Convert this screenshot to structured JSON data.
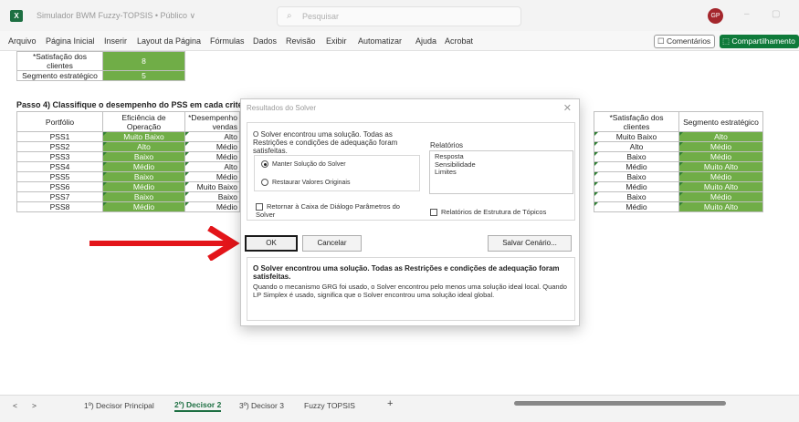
{
  "titlebar": {
    "doc_title": "Simulador BWM Fuzzy-TOPSIS  •  Público ∨",
    "search_placeholder": "Pesquisar",
    "avatar_initials": "GP",
    "minimize": "–",
    "restore": "▢"
  },
  "menu": [
    "Arquivo",
    "Página Inicial",
    "Inserir",
    "Layout da Página",
    "Fórmulas",
    "Dados",
    "Revisão",
    "Exibir",
    "Automatizar",
    "Ajuda",
    "Acrobat"
  ],
  "ribbon": {
    "comments": "☐ Comentários",
    "share": "⬚ Compartilhamento"
  },
  "top_rows": [
    {
      "label": "*Satisfação dos clientes",
      "value": "8"
    },
    {
      "label": "Segmento estratégico",
      "value": "5"
    }
  ],
  "step_title": "Passo 4) Classifique o desempenho do PSS em cada critério",
  "left_table": {
    "headers": [
      "Portfólio",
      "Eficiência de Operação",
      "*Desempenho vendas"
    ],
    "rows": [
      [
        "PSS1",
        "Muito Baixo",
        "Alto"
      ],
      [
        "PSS2",
        "Alto",
        "Médio"
      ],
      [
        "PSS3",
        "Baixo",
        "Médio"
      ],
      [
        "PSS4",
        "Médio",
        "Alto"
      ],
      [
        "PSS5",
        "Baixo",
        "Médio"
      ],
      [
        "PSS6",
        "Médio",
        "Muito Baixo"
      ],
      [
        "PSS7",
        "Baixo",
        "Baixo"
      ],
      [
        "PSS8",
        "Médio",
        "Médio"
      ]
    ]
  },
  "right_table": {
    "headers": [
      "*Satisfação dos clientes",
      "Segmento estratégico"
    ],
    "rows": [
      [
        "Muito Baixo",
        "Alto"
      ],
      [
        "Alto",
        "Médio"
      ],
      [
        "Baixo",
        "Médio"
      ],
      [
        "Médio",
        "Muito Alto"
      ],
      [
        "Baixo",
        "Médio"
      ],
      [
        "Médio",
        "Muito Alto"
      ],
      [
        "Baixo",
        "Médio"
      ],
      [
        "Médio",
        "Muito Alto"
      ]
    ]
  },
  "dialog": {
    "title": "Resultados do Solver",
    "close": "✕",
    "message": "O Solver encontrou uma solução. Todas as Restrições e condições de adequação foram satisfeitas.",
    "reports_label": "Relatórios",
    "reports": [
      "Resposta",
      "Sensibilidade",
      "Limites"
    ],
    "radio_keep": "Manter Solução do Solver",
    "radio_restore": "Restaurar Valores Originais",
    "chk_return": "Retornar à Caixa de Diálogo Parâmetros do Solver",
    "chk_outline": "Relatórios de Estrutura de Tópicos",
    "btn_ok": "OK",
    "btn_cancel": "Cancelar",
    "btn_save": "Salvar Cenário...",
    "bottom_bold": "O Solver encontrou uma solução.  Todas as Restrições e condições de adequação foram satisfeitas.",
    "bottom_desc": "Quando o mecanismo GRG foi usado, o Solver encontrou pelo menos uma solução ideal local. Quando LP Simplex é usado, significa que o Solver encontrou uma solução ideal global."
  },
  "tabs": {
    "nav_prev": "<",
    "nav_next": ">",
    "items": [
      "1º) Decisor Principal",
      "2º) Decisor 2",
      "3º) Decisor 3",
      "Fuzzy TOPSIS"
    ],
    "add": "+"
  },
  "colors": {
    "green": "#70ad47",
    "excel": "#1d6f42",
    "arrow": "#e3151a"
  }
}
